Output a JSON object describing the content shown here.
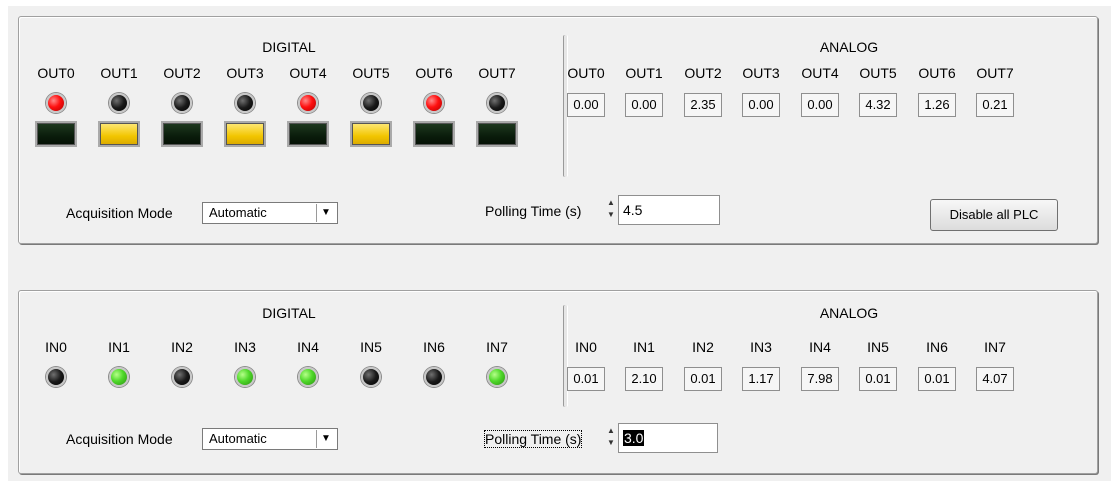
{
  "outputs": {
    "digital_title": "DIGITAL",
    "analog_title": "ANALOG",
    "digital_channels": [
      {
        "label": "OUT0",
        "led": "red",
        "switch": "off"
      },
      {
        "label": "OUT1",
        "led": "dark",
        "switch": "on"
      },
      {
        "label": "OUT2",
        "led": "dark",
        "switch": "off"
      },
      {
        "label": "OUT3",
        "led": "dark",
        "switch": "on"
      },
      {
        "label": "OUT4",
        "led": "red",
        "switch": "off"
      },
      {
        "label": "OUT5",
        "led": "dark",
        "switch": "on"
      },
      {
        "label": "OUT6",
        "led": "red",
        "switch": "off"
      },
      {
        "label": "OUT7",
        "led": "dark",
        "switch": "off"
      }
    ],
    "analog_channels": [
      {
        "label": "OUT0",
        "value": "0.00"
      },
      {
        "label": "OUT1",
        "value": "0.00"
      },
      {
        "label": "OUT2",
        "value": "2.35"
      },
      {
        "label": "OUT3",
        "value": "0.00"
      },
      {
        "label": "OUT4",
        "value": "0.00"
      },
      {
        "label": "OUT5",
        "value": "4.32"
      },
      {
        "label": "OUT6",
        "value": "1.26"
      },
      {
        "label": "OUT7",
        "value": "0.21"
      }
    ],
    "acq_label": "Acquisition Mode",
    "acq_value": "Automatic",
    "poll_label": "Polling Time (s)",
    "poll_value": "4.5",
    "disable_button": "Disable all PLC"
  },
  "inputs": {
    "digital_title": "DIGITAL",
    "analog_title": "ANALOG",
    "digital_channels": [
      {
        "label": "IN0",
        "led": "dark"
      },
      {
        "label": "IN1",
        "led": "green"
      },
      {
        "label": "IN2",
        "led": "dark"
      },
      {
        "label": "IN3",
        "led": "green"
      },
      {
        "label": "IN4",
        "led": "green"
      },
      {
        "label": "IN5",
        "led": "dark"
      },
      {
        "label": "IN6",
        "led": "dark"
      },
      {
        "label": "IN7",
        "led": "green"
      }
    ],
    "analog_channels": [
      {
        "label": "IN0",
        "value": "0.01"
      },
      {
        "label": "IN1",
        "value": "2.10"
      },
      {
        "label": "IN2",
        "value": "0.01"
      },
      {
        "label": "IN3",
        "value": "1.17"
      },
      {
        "label": "IN4",
        "value": "7.98"
      },
      {
        "label": "IN5",
        "value": "0.01"
      },
      {
        "label": "IN6",
        "value": "0.01"
      },
      {
        "label": "IN7",
        "value": "4.07"
      }
    ],
    "acq_label": "Acquisition Mode",
    "acq_value": "Automatic",
    "poll_label": "Polling Time (s)",
    "poll_value": "3.0"
  },
  "colors": {
    "led_red": "#ff1010",
    "led_green": "#4fd82a",
    "led_off": "#1a1a1a",
    "switch_on": "#f2c500",
    "switch_off": "#0a1c0b"
  },
  "icons": {
    "combo_arrow": "triangle-down-icon",
    "spin": "spin-up-down-icon"
  }
}
